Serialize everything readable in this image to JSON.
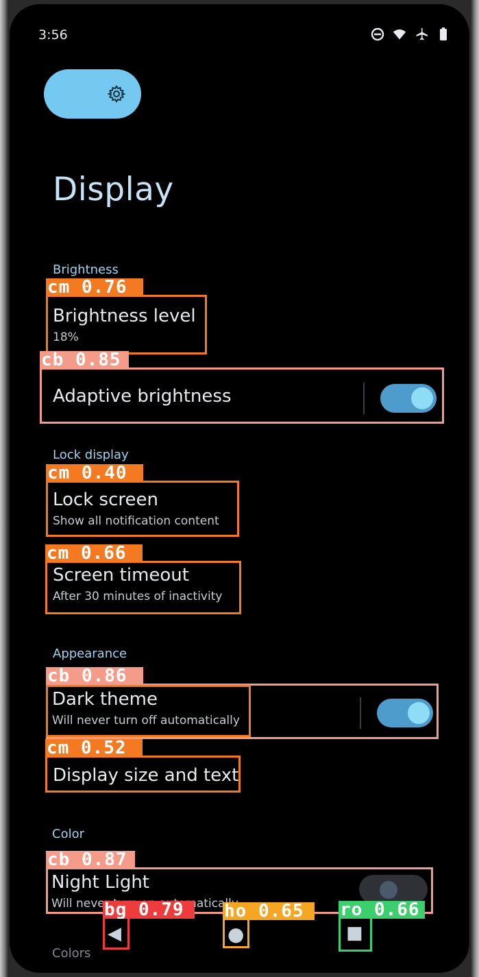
{
  "status_bar": {
    "time": "3:56",
    "icons": [
      "do-not-disturb-icon",
      "wifi-icon",
      "airplane-icon",
      "battery-icon"
    ]
  },
  "settings_pill": {
    "icon": "gear-icon"
  },
  "page_title": "Display",
  "sections": {
    "brightness": {
      "header": "Brightness",
      "brightness_level": {
        "title": "Brightness level",
        "subtitle": "18%"
      },
      "adaptive_brightness": {
        "title": "Adaptive brightness",
        "toggle": "on"
      }
    },
    "lock_display": {
      "header": "Lock display",
      "lock_screen": {
        "title": "Lock screen",
        "subtitle": "Show all notification content"
      },
      "screen_timeout": {
        "title": "Screen timeout",
        "subtitle": "After 30 minutes of inactivity"
      }
    },
    "appearance": {
      "header": "Appearance",
      "dark_theme": {
        "title": "Dark theme",
        "subtitle": "Will never turn off automatically",
        "toggle": "on"
      },
      "display_size": {
        "title": "Display size and text"
      }
    },
    "color": {
      "header": "Color",
      "night_light": {
        "title": "Night Light",
        "subtitle": "Will never turn on automatically",
        "toggle": "off"
      },
      "next_header": "Colors"
    }
  },
  "nav_bar": {
    "back": "◀",
    "home": "●",
    "recents": "■"
  },
  "detections": [
    {
      "label": "cm 0.76",
      "class": "cm"
    },
    {
      "label": "cb 0.85",
      "class": "cb"
    },
    {
      "label": "cm 0.40",
      "class": "cm"
    },
    {
      "label": "cm 0.66",
      "class": "cm"
    },
    {
      "label": "cb 0.86",
      "class": "cb"
    },
    {
      "label": "cm 0.52",
      "class": "cm"
    },
    {
      "label": "cb 0.87",
      "class": "cb"
    },
    {
      "label": "bg 0.79",
      "class": "bg"
    },
    {
      "label": "ho 0.65",
      "class": "ho"
    },
    {
      "label": "ro 0.66",
      "class": "ro"
    }
  ],
  "colors": {
    "background": "#000000",
    "accent": "#75c8ef",
    "title": "#c7e3f6",
    "section_header": "#9fd3f1",
    "toggle_on": "#4e9ccc"
  }
}
